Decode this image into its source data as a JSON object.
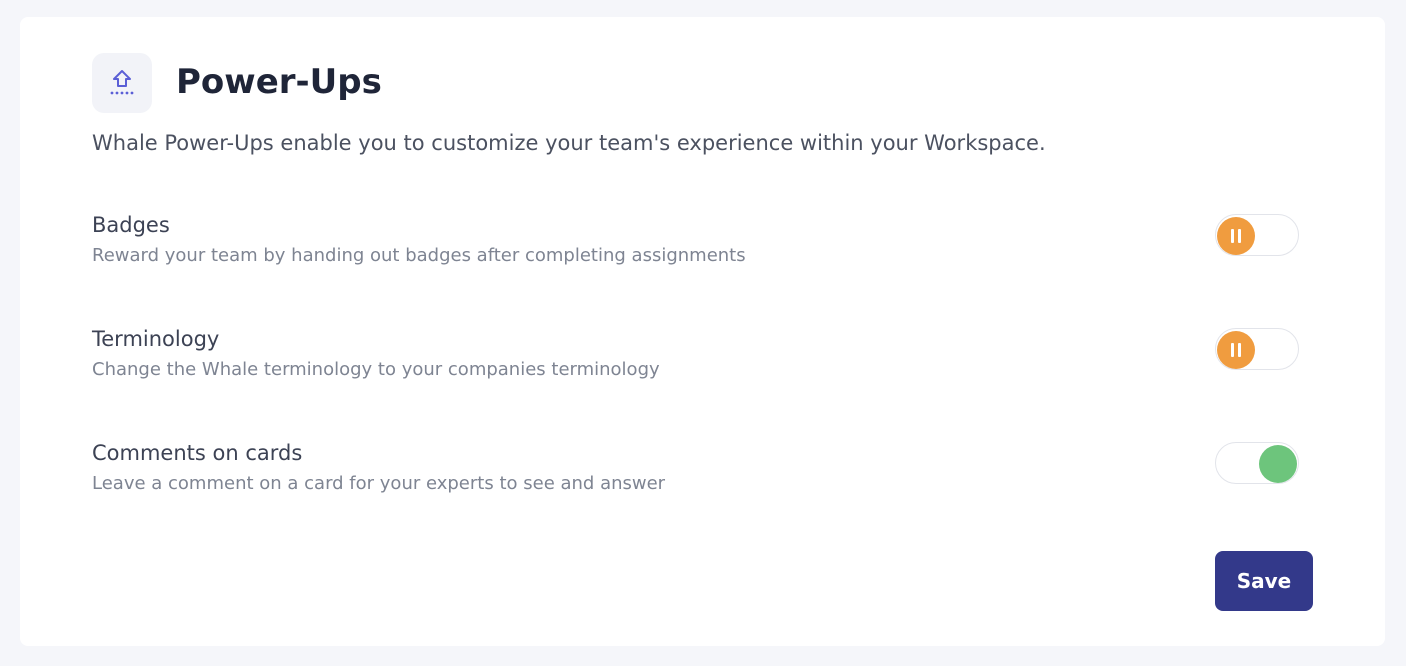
{
  "header": {
    "icon": "power-up-arrow-icon",
    "title": "Power-Ups",
    "description": "Whale Power-Ups enable you to customize your team's experience within your Workspace."
  },
  "powerups": [
    {
      "title": "Badges",
      "description": "Reward your team by handing out badges after completing assignments",
      "enabled": false
    },
    {
      "title": "Terminology",
      "description": "Change the Whale terminology to your companies terminology",
      "enabled": false
    },
    {
      "title": "Comments on cards",
      "description": "Leave a comment on a card for your experts to see and answer",
      "enabled": true
    }
  ],
  "actions": {
    "save_label": "Save"
  },
  "colors": {
    "accent": "#33398a",
    "toggle_off": "#f09c3f",
    "toggle_on": "#6dc57c",
    "icon": "#5b5fd6"
  }
}
